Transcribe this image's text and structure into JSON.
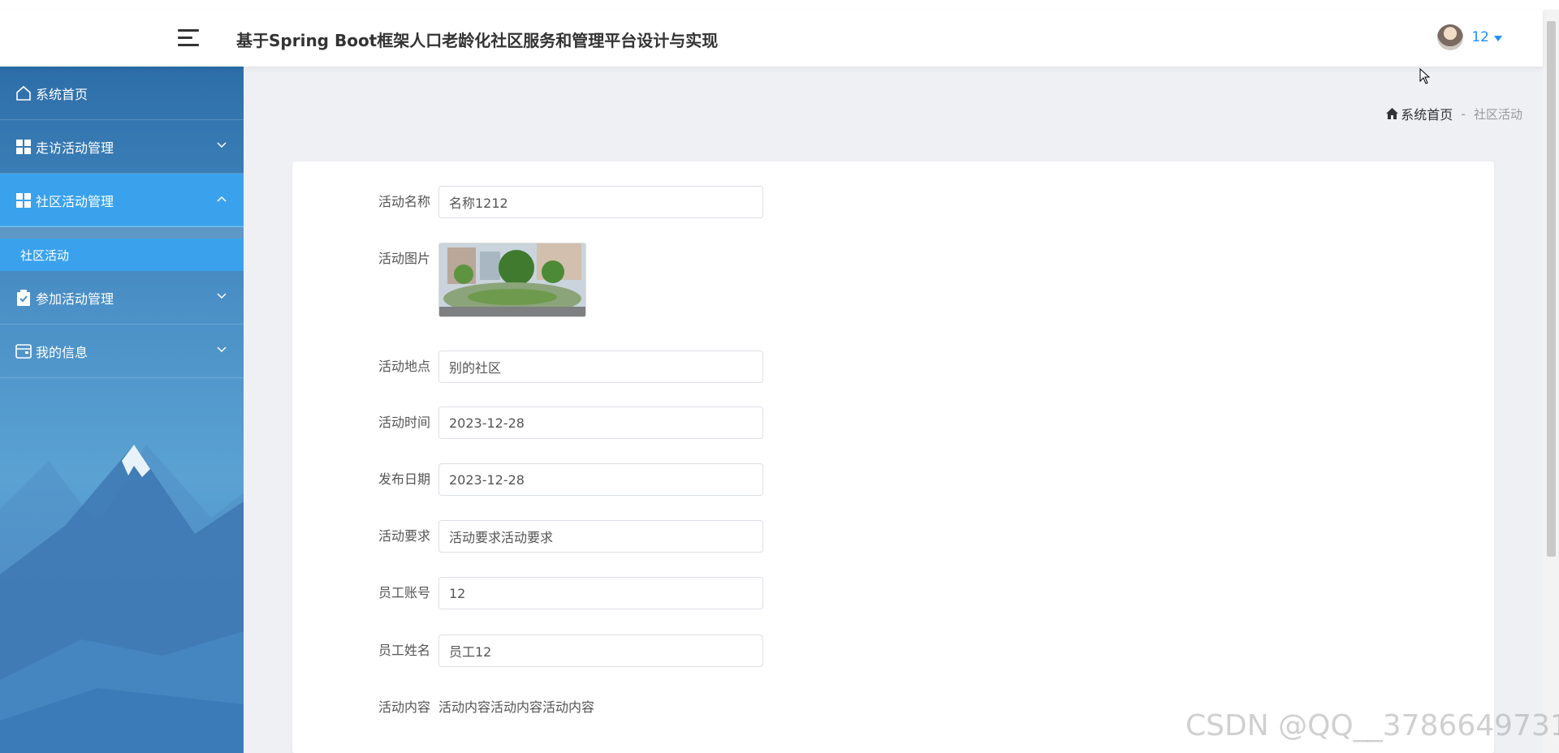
{
  "header": {
    "title": "基于Spring Boot框架人口老龄化社区服务和管理平台设计与实现",
    "user_name": "12"
  },
  "sidebar": {
    "items": [
      {
        "label": "系统首页",
        "icon": "home-icon"
      },
      {
        "label": "走访活动管理",
        "icon": "grid-icon"
      },
      {
        "label": "社区活动管理",
        "icon": "grid-icon"
      },
      {
        "label": "参加活动管理",
        "icon": "clipboard-icon"
      },
      {
        "label": "我的信息",
        "icon": "wallet-icon"
      }
    ],
    "sub_item": "社区活动"
  },
  "breadcrumb": {
    "home": "系统首页",
    "separator": "-",
    "current": "社区活动"
  },
  "form": {
    "activity_name": {
      "label": "活动名称",
      "value": "名称1212"
    },
    "activity_image": {
      "label": "活动图片"
    },
    "activity_location": {
      "label": "活动地点",
      "value": "别的社区"
    },
    "activity_time": {
      "label": "活动时间",
      "value": "2023-12-28"
    },
    "publish_date": {
      "label": "发布日期",
      "value": "2023-12-28"
    },
    "activity_requirement": {
      "label": "活动要求",
      "value": "活动要求活动要求"
    },
    "staff_account": {
      "label": "员工账号",
      "value": "12"
    },
    "staff_name": {
      "label": "员工姓名",
      "value": "员工12"
    },
    "activity_content": {
      "label": "活动内容",
      "value": "活动内容活动内容活动内容"
    }
  },
  "watermark": "CSDN @QQ__3786649731",
  "colors": {
    "accent": "#3aa2ec",
    "link": "#1e90ff",
    "sidebar": "#4b90c6"
  }
}
